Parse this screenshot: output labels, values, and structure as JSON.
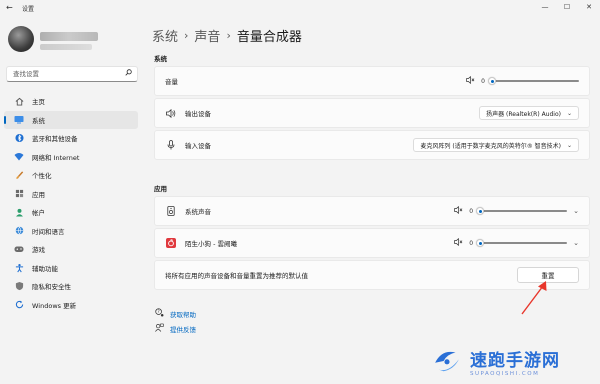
{
  "window": {
    "title": "设置",
    "back": "←",
    "controls": [
      "—",
      "☐",
      "✕"
    ]
  },
  "user": {},
  "search": {
    "placeholder": "查找设置",
    "icon": "search-icon"
  },
  "sidebar": {
    "items": [
      {
        "label": "主页",
        "icon": "home-icon",
        "active": false
      },
      {
        "label": "系统",
        "icon": "system-icon",
        "active": true
      },
      {
        "label": "蓝牙和其他设备",
        "icon": "bluetooth-icon",
        "active": false
      },
      {
        "label": "网络和 Internet",
        "icon": "wifi-icon",
        "active": false
      },
      {
        "label": "个性化",
        "icon": "brush-icon",
        "active": false
      },
      {
        "label": "应用",
        "icon": "apps-icon",
        "active": false
      },
      {
        "label": "帐户",
        "icon": "account-icon",
        "active": false
      },
      {
        "label": "时间和语言",
        "icon": "globe-icon",
        "active": false
      },
      {
        "label": "游戏",
        "icon": "gaming-icon",
        "active": false
      },
      {
        "label": "辅助功能",
        "icon": "accessibility-icon",
        "active": false
      },
      {
        "label": "隐私和安全性",
        "icon": "shield-icon",
        "active": false
      },
      {
        "label": "Windows 更新",
        "icon": "update-icon",
        "active": false
      }
    ]
  },
  "breadcrumb": {
    "part1": "系统",
    "part2": "声音",
    "current": "音量合成器",
    "sep": "›"
  },
  "system_section": {
    "heading": "系统",
    "volume": {
      "label": "音量",
      "value": "0",
      "level": 0
    },
    "output": {
      "label": "输出设备",
      "selected": "扬声器 (Realtek(R) Audio)"
    },
    "input": {
      "label": "输入设备",
      "selected": "麦克风阵列 (适用于数字麦克风的英特尔® 智音技术)"
    }
  },
  "apps_section": {
    "heading": "应用",
    "apps": [
      {
        "label": "系统声音",
        "value": "0",
        "level": 0,
        "icon": "speaker-device-icon"
      },
      {
        "label": "陌生小狗 - 雲阙曦",
        "value": "0",
        "level": 0,
        "icon": "netease-music-icon"
      }
    ],
    "reset": {
      "description": "将所有应用的声音设备和音量重置为推荐的默认值",
      "button": "重置"
    }
  },
  "links": {
    "help": "获取帮助",
    "feedback": "提供反馈"
  },
  "watermark": {
    "title": "速跑手游网",
    "subtitle": "SUPAOQISHI.COM"
  },
  "colors": {
    "accent": "#0067c0",
    "annotation_arrow": "#e8362b",
    "watermark": "#2a6fd6"
  }
}
